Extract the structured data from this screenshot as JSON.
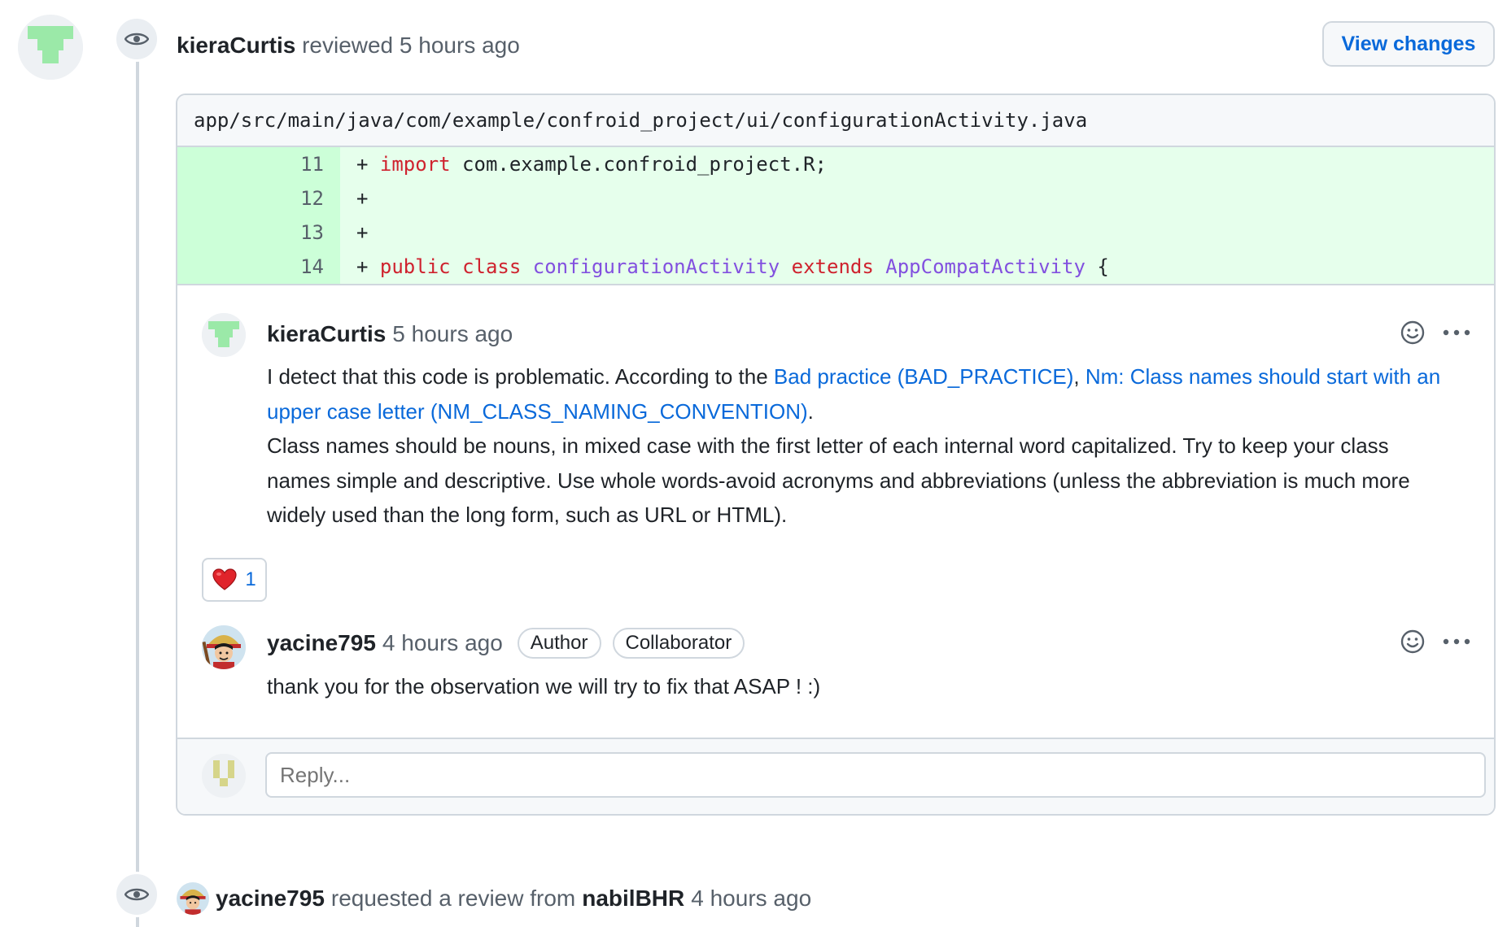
{
  "review_event": {
    "user": "kieraCurtis",
    "action": "reviewed",
    "time": "5 hours ago",
    "view_changes_label": "View changes"
  },
  "file": {
    "path": "app/src/main/java/com/example/confroid_project/ui/configurationActivity.java",
    "lines": [
      {
        "num": "11",
        "prefix": "+ ",
        "tokens": [
          {
            "t": "import",
            "c": "kw"
          },
          {
            "t": " com.example.confroid_project.R;",
            "c": ""
          }
        ]
      },
      {
        "num": "12",
        "prefix": "+",
        "tokens": []
      },
      {
        "num": "13",
        "prefix": "+",
        "tokens": []
      },
      {
        "num": "14",
        "prefix": "+ ",
        "tokens": [
          {
            "t": "public",
            "c": "kw"
          },
          {
            "t": " ",
            "c": ""
          },
          {
            "t": "class",
            "c": "kw"
          },
          {
            "t": " ",
            "c": ""
          },
          {
            "t": "configurationActivity",
            "c": "cls"
          },
          {
            "t": " ",
            "c": ""
          },
          {
            "t": "extends",
            "c": "kw"
          },
          {
            "t": " ",
            "c": ""
          },
          {
            "t": "AppCompatActivity",
            "c": "cls"
          },
          {
            "t": " {",
            "c": ""
          }
        ]
      }
    ]
  },
  "comment1": {
    "user": "kieraCurtis",
    "time": "5 hours ago",
    "text_intro": "I detect that this code is problematic. According to the ",
    "link1": "Bad practice (BAD_PRACTICE)",
    "separator": ", ",
    "link2": "Nm: Class names should start with an upper case letter (NM_CLASS_NAMING_CONVENTION)",
    "period": ".",
    "text_body": "Class names should be nouns, in mixed case with the first letter of each internal word capitalized. Try to keep your class names simple and descriptive. Use whole words-avoid acronyms and abbreviations (unless the abbreviation is much more widely used than the long form, such as URL or HTML).",
    "reaction_emoji": "heart",
    "reaction_count": "1"
  },
  "comment2": {
    "user": "yacine795",
    "time": "4 hours ago",
    "badges": [
      "Author",
      "Collaborator"
    ],
    "text": "thank you for the observation we will try to fix that ASAP ! :)"
  },
  "reply": {
    "placeholder": "Reply..."
  },
  "request_event": {
    "user": "yacine795",
    "action": "requested a review from",
    "reviewer": "nabilBHR",
    "time": "4 hours ago"
  },
  "colors": {
    "link": "#0969da",
    "added_line_bg": "#e6ffec",
    "added_num_bg": "#ccffd8",
    "keyword": "#cf222e",
    "class_name": "#8250df",
    "identicon": "#9be9a8"
  }
}
